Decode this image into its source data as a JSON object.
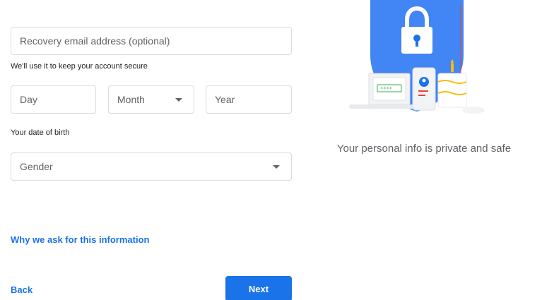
{
  "form": {
    "recovery_email": {
      "placeholder": "Recovery email address (optional)",
      "helper": "We'll use it to keep your account secure"
    },
    "birthdate": {
      "day_placeholder": "Day",
      "month_selected": "Month",
      "year_placeholder": "Year",
      "helper": "Your date of birth"
    },
    "gender": {
      "selected": "Gender"
    },
    "why_link": "Why we ask for this information",
    "back_label": "Back",
    "next_label": "Next"
  },
  "side_panel": {
    "caption": "Your personal info is private and safe"
  },
  "colors": {
    "accent": "#1a73e8",
    "border": "#dadce0",
    "muted_text": "#5f6368"
  }
}
